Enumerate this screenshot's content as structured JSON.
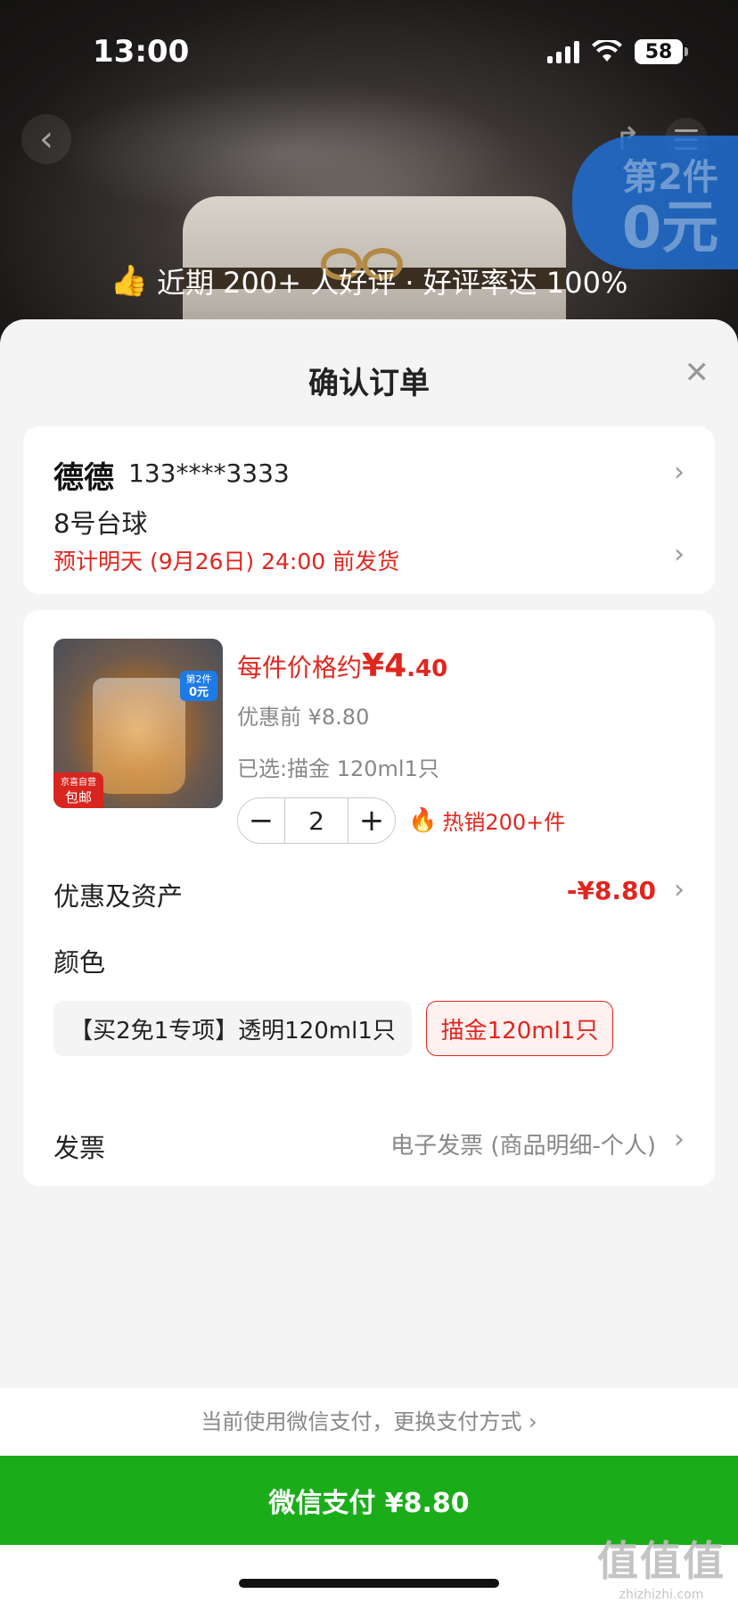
{
  "status": {
    "time": "13:00",
    "battery": "58"
  },
  "hero": {
    "review_text": "近期 200+ 人好评 · 好评率达 100%",
    "promo_line1": "第2件",
    "promo_line2": "0元"
  },
  "sheet": {
    "title": "确认订单"
  },
  "address": {
    "name": "德德",
    "phone": "133****3333",
    "line": "8号台球",
    "shipping": "预计明天 (9月26日) 24:00 前发货"
  },
  "product": {
    "price_prefix": "每件价格约",
    "price_currency": "¥",
    "price_int": "4",
    "price_dec": ".40",
    "pre_price": "优惠前 ¥8.80",
    "selected": "已选:描金 120ml1只",
    "quantity": "2",
    "hot": "热销200+件",
    "img_tag_line1": "第2件",
    "img_tag_line2": "0元",
    "img_mail_line1": "京喜自营",
    "img_mail_line2": "包邮"
  },
  "discount": {
    "label": "优惠及资产",
    "value": "-¥8.80"
  },
  "color": {
    "label": "颜色",
    "options": [
      "【买2免1专项】透明120ml1只",
      "描金120ml1只"
    ],
    "selected_index": 1
  },
  "invoice": {
    "label": "发票",
    "value": "电子发票 (商品明细-个人)"
  },
  "payment": {
    "switch_text": "当前使用微信支付，更换支付方式 ›",
    "button": "微信支付 ¥8.80"
  },
  "watermark": {
    "line1": "值值值",
    "line2": "zhizhizhi.com"
  },
  "colors": {
    "accent_red": "#e0261e",
    "wechat_green": "#1aad19"
  }
}
